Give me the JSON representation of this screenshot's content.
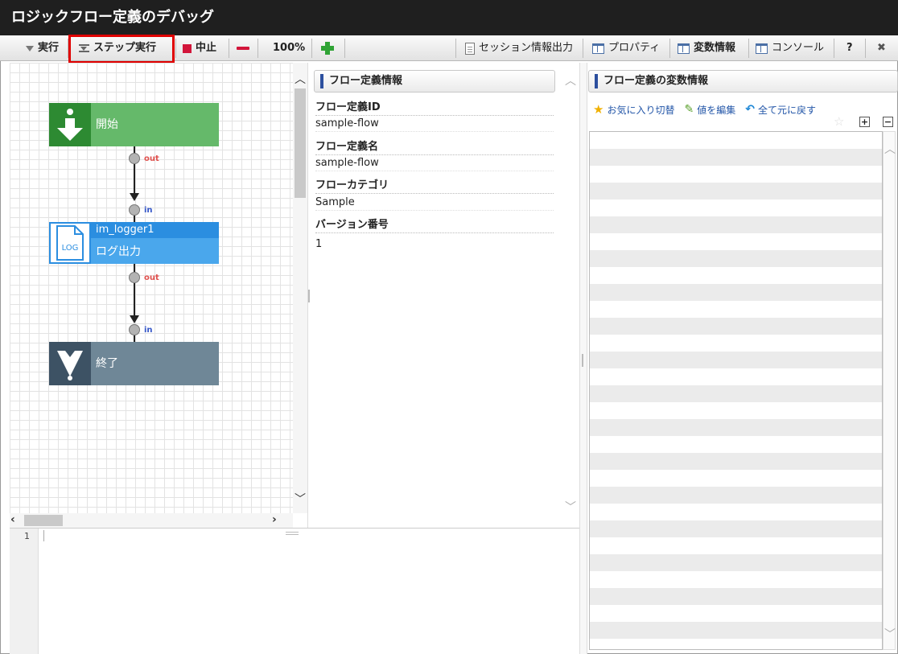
{
  "window": {
    "title": "ロジックフロー定義のデバッグ"
  },
  "toolbar": {
    "run_label": "実行",
    "step_label": "ステップ実行",
    "stop_label": "中止",
    "zoom_value": "100%",
    "session_label": "セッション情報出力",
    "property_label": "プロパティ",
    "variable_label": "変数情報",
    "console_label": "コンソール",
    "help_label": "?",
    "close_label": "✖"
  },
  "flow": {
    "start_label": "開始",
    "log_node_id": "im_logger1",
    "log_icon_text": "LOG",
    "log_label": "ログ出力",
    "end_label": "終了",
    "port_out": "out",
    "port_in": "in"
  },
  "definition_panel": {
    "title": "フロー定義情報",
    "fields": [
      {
        "label": "フロー定義ID",
        "value": "sample-flow"
      },
      {
        "label": "フロー定義名",
        "value": "sample-flow"
      },
      {
        "label": "フローカテゴリ",
        "value": "Sample"
      },
      {
        "label": "バージョン番号",
        "value": "1"
      }
    ]
  },
  "variables_panel": {
    "title": "フロー定義の変数情報",
    "favorite_label": "お気に入り切替",
    "edit_label": "値を編集",
    "reset_label": "全て元に戻す"
  },
  "console": {
    "line_number": "1"
  }
}
